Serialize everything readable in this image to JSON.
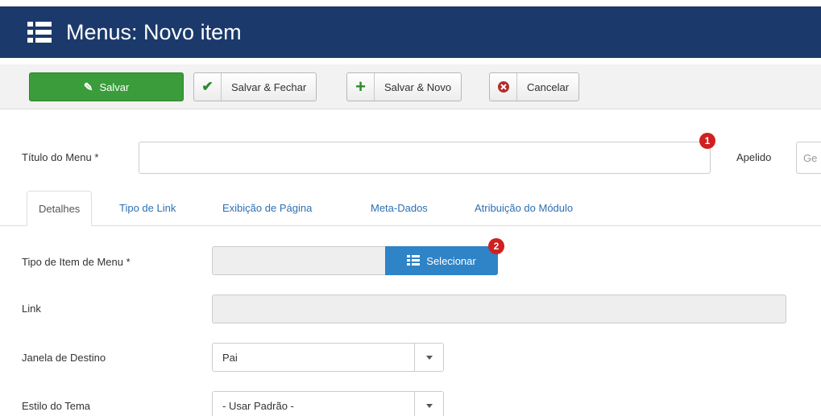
{
  "header": {
    "title": "Menus: Novo item",
    "icon": "list-icon"
  },
  "toolbar": {
    "save_label": "Salvar",
    "save_close_label": "Salvar & Fechar",
    "save_new_label": "Salvar & Novo",
    "cancel_label": "Cancelar"
  },
  "form": {
    "menu_title_label": "Título do Menu *",
    "menu_title_value": "",
    "alias_label": "Apelido",
    "alias_placeholder": "Ge",
    "badge_1": "1",
    "badge_2": "2"
  },
  "tabs": [
    {
      "label": "Detalhes"
    },
    {
      "label": "Tipo de Link"
    },
    {
      "label": "Exibição de Página"
    },
    {
      "label": "Meta-Dados"
    },
    {
      "label": "Atribuição do Módulo"
    }
  ],
  "details": {
    "menu_item_type_label": "Tipo de Item de Menu *",
    "select_button_label": "Selecionar",
    "link_label": "Link",
    "target_window_label": "Janela de Destino",
    "target_window_value": "Pai",
    "template_style_label": "Estilo do Tema",
    "template_style_value": "- Usar Padrão -"
  },
  "colors": {
    "header_bg": "#1b3a6b",
    "save_bg": "#3a9c3a",
    "primary": "#2f83c7",
    "badge": "#d0201f"
  }
}
